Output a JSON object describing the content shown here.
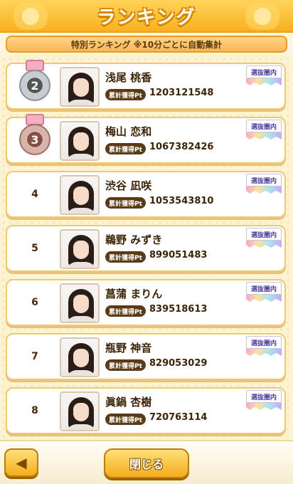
{
  "header": {
    "title": "ランキング"
  },
  "subtitle": "特別ランキング ※10分ごとに自動集計",
  "pt_label": "累計獲得Pt",
  "badge": "選抜圏内",
  "rows": [
    {
      "rank": "2",
      "name": "浅尾 桃香",
      "points": "1203121548",
      "medal": "silver"
    },
    {
      "rank": "3",
      "name": "梅山 恋和",
      "points": "1067382426",
      "medal": "bronze"
    },
    {
      "rank": "4",
      "name": "渋谷 凪咲",
      "points": "1053543810",
      "medal": ""
    },
    {
      "rank": "5",
      "name": "鵜野 みずき",
      "points": "899051483",
      "medal": ""
    },
    {
      "rank": "6",
      "name": "菖蒲 まりん",
      "points": "839518613",
      "medal": ""
    },
    {
      "rank": "7",
      "name": "瓶野 神音",
      "points": "829053029",
      "medal": ""
    },
    {
      "rank": "8",
      "name": "眞鍋 杏樹",
      "points": "720763114",
      "medal": ""
    }
  ],
  "footer": {
    "back_icon": "◀",
    "close_label": "閉じる"
  },
  "colors": {
    "accent": "#f4ad1c",
    "dark_brown": "#5a3b15",
    "row_border": "#f1c870"
  }
}
